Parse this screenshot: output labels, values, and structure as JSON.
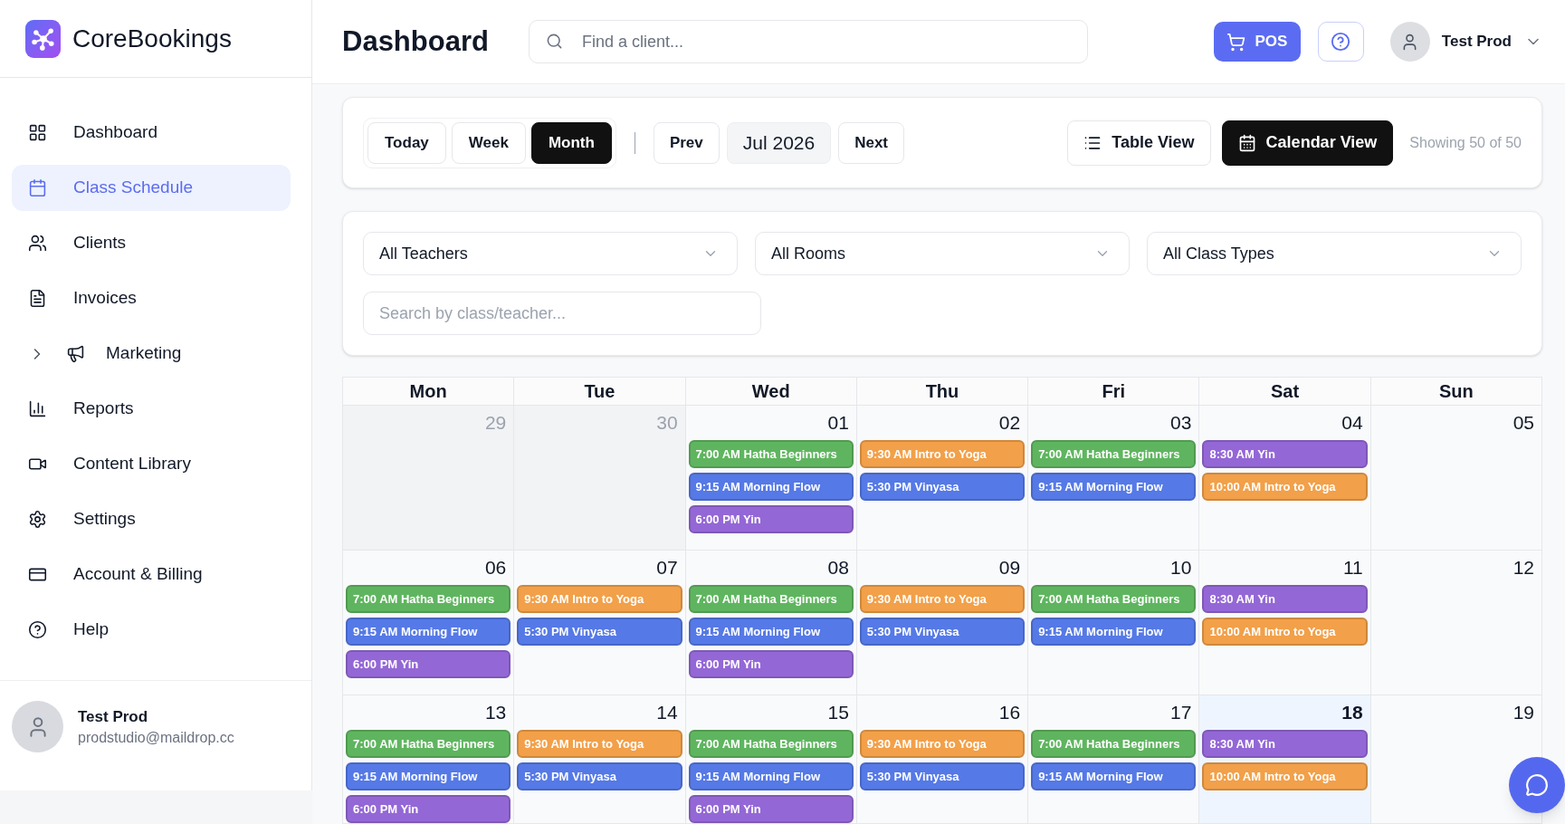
{
  "sidebar": {
    "brand": "CoreBookings",
    "items": [
      {
        "kind": "link",
        "label": "Dashboard",
        "selected": false
      },
      {
        "kind": "link",
        "label": "Class Schedule",
        "selected": true
      },
      {
        "kind": "link",
        "label": "Clients",
        "selected": false
      },
      {
        "kind": "link",
        "label": "Invoices",
        "selected": false
      },
      {
        "kind": "group",
        "label": "Marketing",
        "selected": false,
        "expanded": false
      },
      {
        "kind": "link",
        "label": "Reports",
        "selected": false
      },
      {
        "kind": "link",
        "label": "Content Library",
        "selected": false
      },
      {
        "kind": "link",
        "label": "Settings",
        "selected": false
      },
      {
        "kind": "link",
        "label": "Account & Billing",
        "selected": false
      },
      {
        "kind": "link",
        "label": "Help",
        "selected": false
      }
    ],
    "user": {
      "name": "Test Prod",
      "email": "prodstudio@maildrop.cc"
    }
  },
  "header": {
    "title": "Dashboard",
    "search": {
      "placeholder": "Find a client..."
    },
    "pos_button": "POS",
    "user_name": "Test Prod"
  },
  "toolbar": {
    "ranges": [
      {
        "label": "Today",
        "selected": false
      },
      {
        "label": "Week",
        "selected": false
      },
      {
        "label": "Month",
        "selected": true
      }
    ],
    "prev": "Prev",
    "period": "Jul 2026",
    "next": "Next",
    "views": [
      {
        "label": "Table View",
        "selected": false
      },
      {
        "label": "Calendar View",
        "selected": true
      }
    ],
    "count": "Showing 50 of 50"
  },
  "filters": {
    "selects": [
      {
        "value": "All Teachers"
      },
      {
        "value": "All Rooms"
      },
      {
        "value": "All Class Types"
      }
    ],
    "search": {
      "placeholder": "Search by class/teacher..."
    }
  },
  "calendar": {
    "weekdays": [
      "Mon",
      "Tue",
      "Wed",
      "Thu",
      "Fri",
      "Sat",
      "Sun"
    ],
    "weeks": [
      {
        "days": [
          {
            "day": "29",
            "outside": true,
            "today": false
          },
          {
            "day": "30",
            "outside": true,
            "today": false
          },
          {
            "day": "01",
            "outside": false,
            "today": false,
            "events": [
              {
                "label": "7:00 AM Hatha Beginners",
                "color": "#5fb55f"
              },
              {
                "label": "9:15 AM Morning Flow",
                "color": "#5579e6"
              },
              {
                "label": "6:00 PM Yin",
                "color": "#9467d6"
              }
            ]
          },
          {
            "day": "02",
            "outside": false,
            "today": false,
            "events": [
              {
                "label": "9:30 AM Intro to Yoga",
                "color": "#f2a049"
              },
              {
                "label": "5:30 PM Vinyasa",
                "color": "#5579e6"
              }
            ]
          },
          {
            "day": "03",
            "outside": false,
            "today": false,
            "events": [
              {
                "label": "7:00 AM Hatha Beginners",
                "color": "#5fb55f"
              },
              {
                "label": "9:15 AM Morning Flow",
                "color": "#5579e6"
              }
            ]
          },
          {
            "day": "04",
            "outside": false,
            "today": false,
            "events": [
              {
                "label": "8:30 AM Yin",
                "color": "#9467d6"
              },
              {
                "label": "10:00 AM Intro to Yoga",
                "color": "#f2a049"
              }
            ]
          },
          {
            "day": "05",
            "outside": false,
            "today": false
          }
        ]
      },
      {
        "days": [
          {
            "day": "06",
            "outside": false,
            "today": false,
            "events": [
              {
                "label": "7:00 AM Hatha Beginners",
                "color": "#5fb55f"
              },
              {
                "label": "9:15 AM Morning Flow",
                "color": "#5579e6"
              },
              {
                "label": "6:00 PM Yin",
                "color": "#9467d6"
              }
            ]
          },
          {
            "day": "07",
            "outside": false,
            "today": false,
            "events": [
              {
                "label": "9:30 AM Intro to Yoga",
                "color": "#f2a049"
              },
              {
                "label": "5:30 PM Vinyasa",
                "color": "#5579e6"
              }
            ]
          },
          {
            "day": "08",
            "outside": false,
            "today": false,
            "events": [
              {
                "label": "7:00 AM Hatha Beginners",
                "color": "#5fb55f"
              },
              {
                "label": "9:15 AM Morning Flow",
                "color": "#5579e6"
              },
              {
                "label": "6:00 PM Yin",
                "color": "#9467d6"
              }
            ]
          },
          {
            "day": "09",
            "outside": false,
            "today": false,
            "events": [
              {
                "label": "9:30 AM Intro to Yoga",
                "color": "#f2a049"
              },
              {
                "label": "5:30 PM Vinyasa",
                "color": "#5579e6"
              }
            ]
          },
          {
            "day": "10",
            "outside": false,
            "today": false,
            "events": [
              {
                "label": "7:00 AM Hatha Beginners",
                "color": "#5fb55f"
              },
              {
                "label": "9:15 AM Morning Flow",
                "color": "#5579e6"
              }
            ]
          },
          {
            "day": "11",
            "outside": false,
            "today": false,
            "events": [
              {
                "label": "8:30 AM Yin",
                "color": "#9467d6"
              },
              {
                "label": "10:00 AM Intro to Yoga",
                "color": "#f2a049"
              }
            ]
          },
          {
            "day": "12",
            "outside": false,
            "today": false
          }
        ]
      },
      {
        "days": [
          {
            "day": "13",
            "outside": false,
            "today": false,
            "events": [
              {
                "label": "7:00 AM Hatha Beginners",
                "color": "#5fb55f"
              },
              {
                "label": "9:15 AM Morning Flow",
                "color": "#5579e6"
              },
              {
                "label": "6:00 PM Yin",
                "color": "#9467d6"
              }
            ]
          },
          {
            "day": "14",
            "outside": false,
            "today": false,
            "events": [
              {
                "label": "9:30 AM Intro to Yoga",
                "color": "#f2a049"
              },
              {
                "label": "5:30 PM Vinyasa",
                "color": "#5579e6"
              }
            ]
          },
          {
            "day": "15",
            "outside": false,
            "today": false,
            "events": [
              {
                "label": "7:00 AM Hatha Beginners",
                "color": "#5fb55f"
              },
              {
                "label": "9:15 AM Morning Flow",
                "color": "#5579e6"
              },
              {
                "label": "6:00 PM Yin",
                "color": "#9467d6"
              }
            ]
          },
          {
            "day": "16",
            "outside": false,
            "today": false,
            "events": [
              {
                "label": "9:30 AM Intro to Yoga",
                "color": "#f2a049"
              },
              {
                "label": "5:30 PM Vinyasa",
                "color": "#5579e6"
              }
            ]
          },
          {
            "day": "17",
            "outside": false,
            "today": false,
            "events": [
              {
                "label": "7:00 AM Hatha Beginners",
                "color": "#5fb55f"
              },
              {
                "label": "9:15 AM Morning Flow",
                "color": "#5579e6"
              }
            ]
          },
          {
            "day": "18",
            "outside": false,
            "today": true,
            "events": [
              {
                "label": "8:30 AM Yin",
                "color": "#9467d6"
              },
              {
                "label": "10:00 AM Intro to Yoga",
                "color": "#f2a049"
              }
            ]
          },
          {
            "day": "19",
            "outside": false,
            "today": false
          }
        ]
      }
    ]
  }
}
